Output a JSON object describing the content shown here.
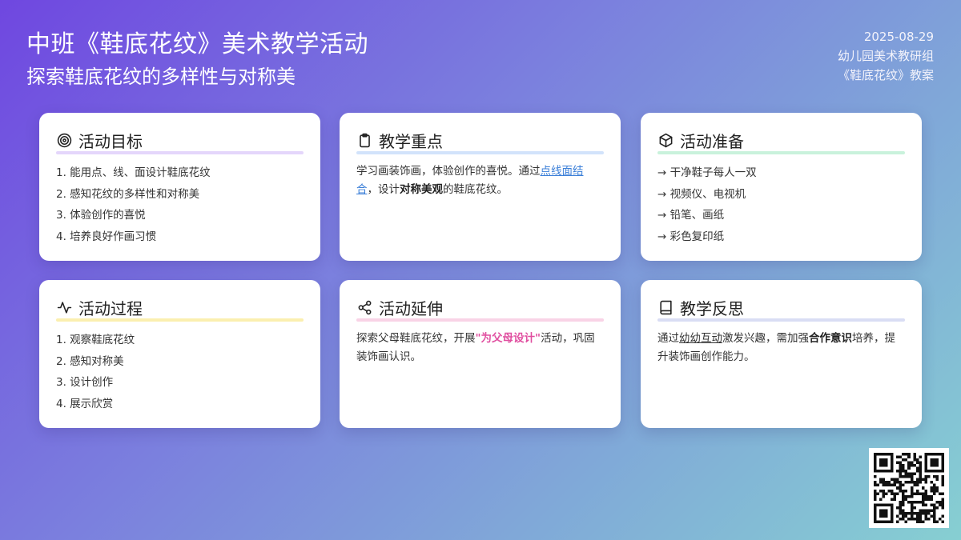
{
  "header": {
    "title": "中班《鞋底花纹》美术教学活动",
    "subtitle": "探索鞋底花纹的多样性与对称美",
    "date": "2025-08-29",
    "group": "幼儿园美术教研组",
    "doc": "《鞋底花纹》教案"
  },
  "cards": {
    "goals": {
      "title": "活动目标",
      "icon": "target-icon",
      "items": [
        "1. 能用点、线、面设计鞋底花纹",
        "2. 感知花纹的多样性和对称美",
        "3. 体验创作的喜悦",
        "4. 培养良好作画习惯"
      ]
    },
    "focus": {
      "title": "教学重点",
      "icon": "clipboard-icon",
      "p1": "学习画装饰画，体验创作的喜悦。通过",
      "link": "点线面结合",
      "p2": "，设计",
      "bold": "对称美观",
      "p3": "的鞋底花纹。"
    },
    "prep": {
      "title": "活动准备",
      "icon": "box-icon",
      "items": [
        "→ 干净鞋子每人一双",
        "→ 视频仪、电视机",
        "→ 铅笔、画纸",
        "→ 彩色复印纸"
      ]
    },
    "process": {
      "title": "活动过程",
      "icon": "activity-icon",
      "items": [
        "1. 观察鞋底花纹",
        "2. 感知对称美",
        "3. 设计创作",
        "4. 展示欣赏"
      ]
    },
    "extension": {
      "title": "活动延伸",
      "icon": "share-icon",
      "p1": "探索父母鞋底花纹，开展",
      "highlight": "\"为父母设计\"",
      "p2": "活动，巩固装饰画认识。"
    },
    "reflection": {
      "title": "教学反思",
      "icon": "book-icon",
      "p1": "通过",
      "underlined": "幼幼互动",
      "p2": "激发兴趣，需加强",
      "bold": "合作意识",
      "p3": "培养，提升装饰画创作能力。"
    }
  },
  "colors": {
    "underline_goals": "#e4d6fb",
    "underline_focus": "#d2e3fb",
    "underline_prep": "#c9f2dc",
    "underline_process": "#fbefb0",
    "underline_extension": "#f9d3e6",
    "underline_reflection": "#d9ddf4",
    "link": "#3b7fd8",
    "highlight": "#e04fa0"
  },
  "qr": {
    "icon": "qr-code-icon"
  }
}
